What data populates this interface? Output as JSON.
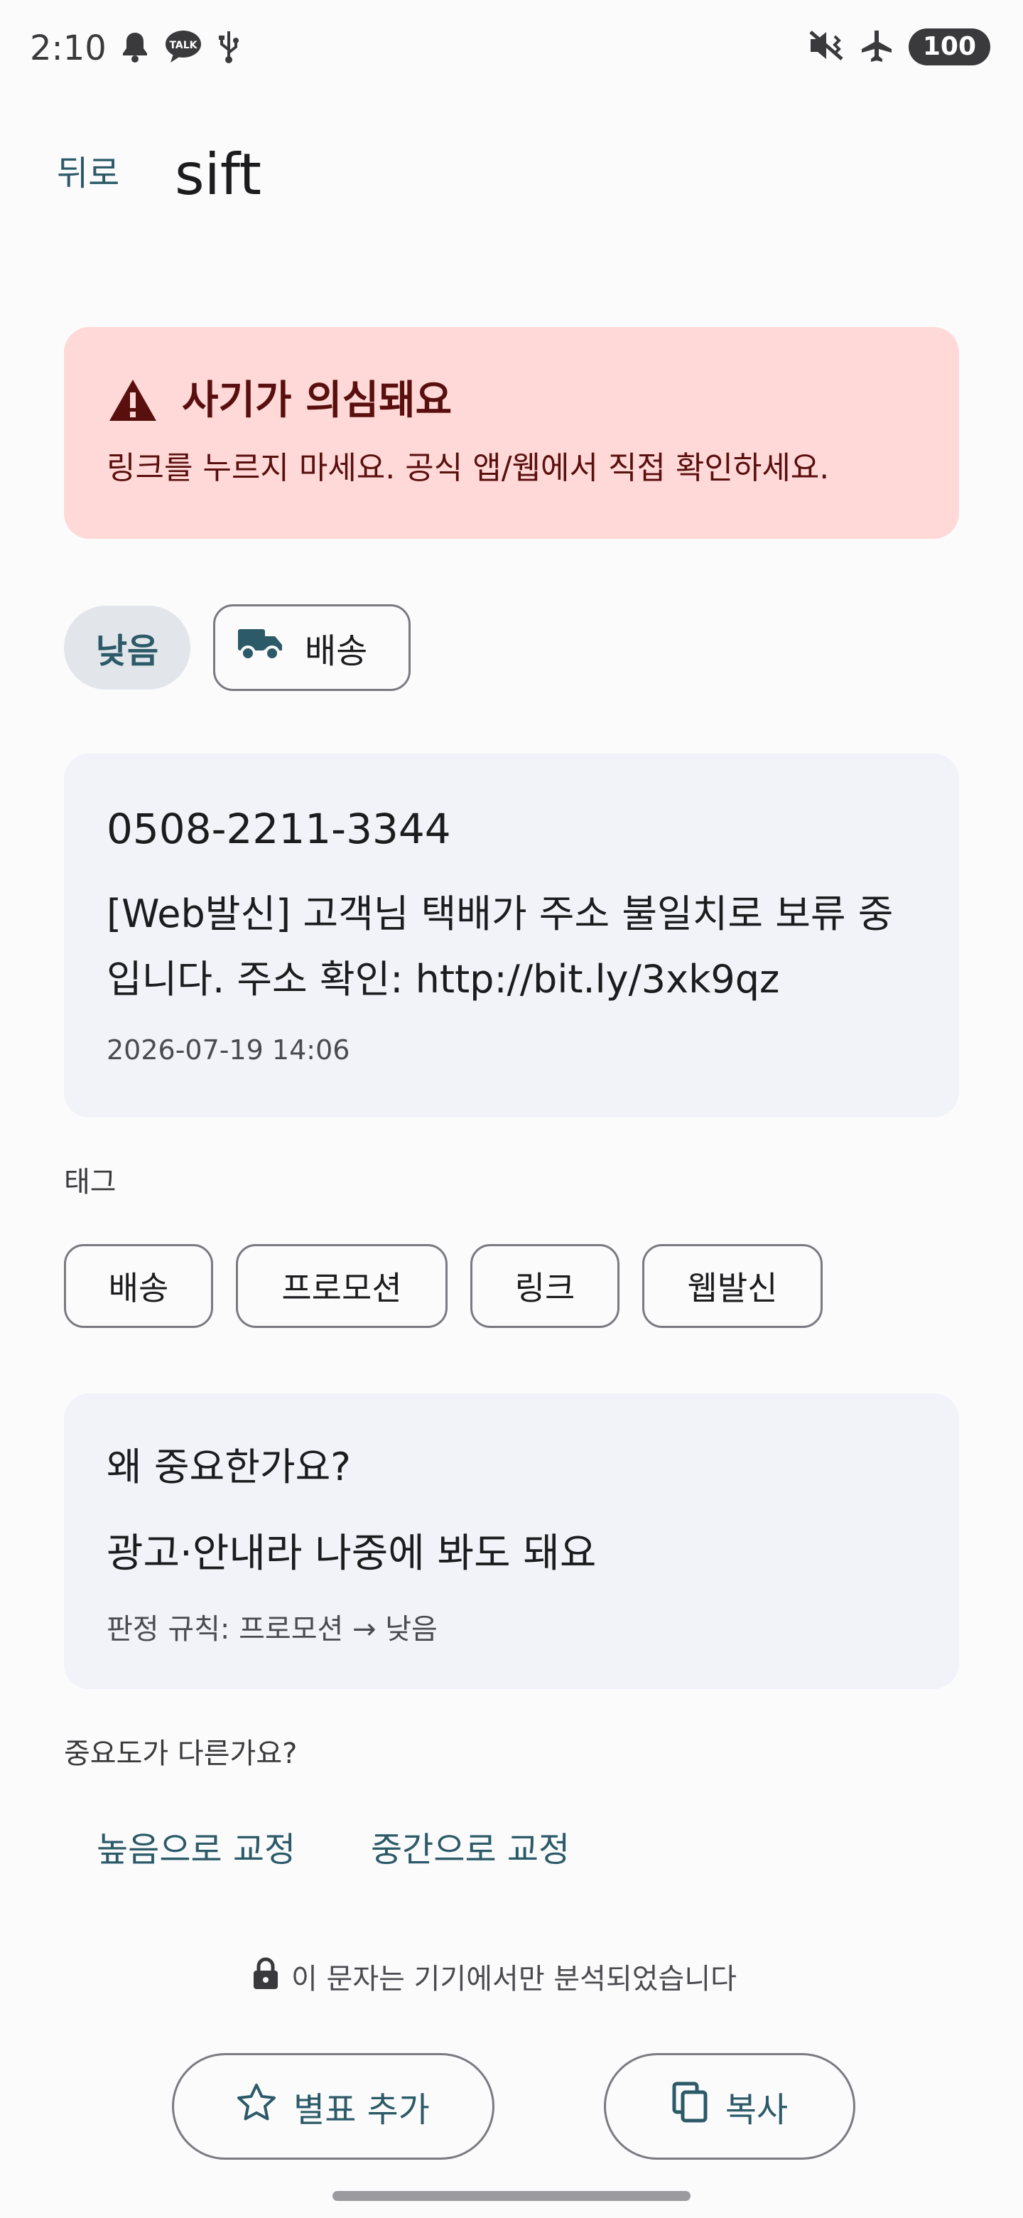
{
  "status_bar": {
    "time": "2:10",
    "battery": "100",
    "left_icons": [
      "bell-icon",
      "kakaotalk-icon",
      "usb-icon"
    ],
    "right_icons": [
      "vibrate-mute-icon",
      "airplane-icon"
    ]
  },
  "top_bar": {
    "back_label": "뒤로",
    "title": "sift"
  },
  "alert": {
    "title": "사기가 의심돼요",
    "body": "링크를 누르지 마세요. 공식 앱/웹에서 직접 확인하세요.",
    "icon": "warning-icon",
    "background": "#ffd9d7",
    "text_color": "#5a0f0f"
  },
  "classification": {
    "level": "낮음",
    "category": "배송",
    "category_icon": "truck-icon"
  },
  "message": {
    "sender": "0508-2211-3344",
    "body": "[Web발신] 고객님 택배가 주소 불일치로 보류 중입니다. 주소 확인: http://bit.ly/3xk9qz",
    "timestamp": "2026-07-19 14:06"
  },
  "tags": {
    "label": "태그",
    "items": [
      "배송",
      "프로모션",
      "링크",
      "웹발신"
    ]
  },
  "why": {
    "title": "왜 중요한가요?",
    "reason": "광고·안내라 나중에 봐도 돼요",
    "rule": "판정 규칙: 프로모션 → 낮음"
  },
  "correction": {
    "question": "중요도가 다른가요?",
    "high_label": "높음으로 교정",
    "medium_label": "중간으로 교정"
  },
  "privacy": {
    "text": "이 문자는 기기에서만 분석되었습니다",
    "icon": "lock-icon"
  },
  "actions": {
    "bookmark_label": "별표 추가",
    "copy_label": "복사"
  },
  "colors": {
    "accent": "#2c5a68",
    "card_bg": "#f1f3f8",
    "page_bg": "#fbfbfc"
  }
}
